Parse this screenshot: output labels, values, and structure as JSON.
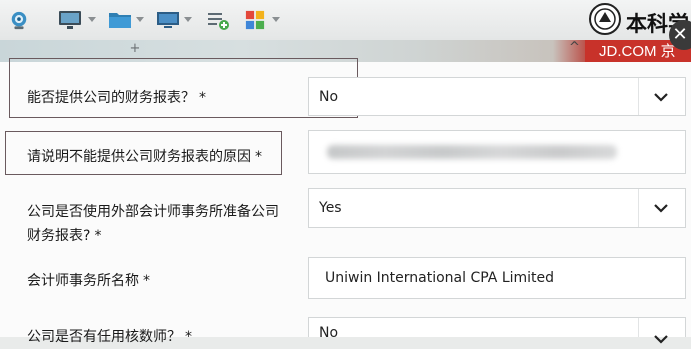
{
  "toolbar": {
    "icons": [
      "webcam-icon",
      "monitor-icon",
      "folder-icon",
      "display-icon",
      "add-list-icon",
      "apps-grid-icon"
    ]
  },
  "browser": {
    "new_tab_glyph": "+",
    "collapse_glyph": "^",
    "banner_text": "JD.COM 京",
    "logo_text": "本科学",
    "close_glyph": "✕"
  },
  "form": {
    "q1": {
      "label": "能否提供公司的财务报表？",
      "required": "*",
      "value": "No"
    },
    "q2": {
      "label": "请说明不能提供公司财务报表的原因",
      "required": "*",
      "value": ""
    },
    "q3": {
      "label_line1": "公司是否使用外部会计师事务所准备公司",
      "label_line2": "财务报表?",
      "required": "*",
      "value": "Yes"
    },
    "q4": {
      "label": "会计师事务所名称",
      "required": "*",
      "value": "Uniwin International CPA Limited"
    },
    "q5": {
      "label": "公司是否有任用核数师？",
      "required": "*",
      "value": "No"
    }
  },
  "colors": {
    "banner": "#c8322a",
    "highlight_box": "#6a5a5e",
    "field_border": "#d3d6d7"
  }
}
